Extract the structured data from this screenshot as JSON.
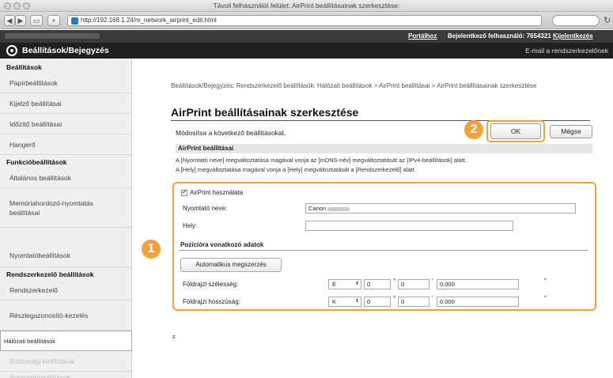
{
  "browser": {
    "window_title": "Távoli felhasználói felület: AirPrint beállításainak szerkesztése:",
    "url": "http://192.168.1.24/m_network_airprint_edit.html",
    "nav_back": "◀",
    "nav_forward": "▶",
    "add_tab": "+",
    "reload": "↻",
    "search_label": "C"
  },
  "app": {
    "top_links": {
      "portal": "Portálhoz",
      "login_label": "Bejelentkező felhasználó:",
      "user_id": "7654321",
      "logout": "Kijelentkezés"
    },
    "header_title": "Beállítások/Bejegyzés",
    "header_right": "E-mail a rendszerkezelőnek"
  },
  "sidebar": {
    "sections": [
      {
        "title": "Beállítások",
        "items": [
          "Papírbeállítások",
          "Kijelző beállításai",
          "Időzítő beállításai",
          "Hangerő"
        ]
      },
      {
        "title": "Funkcióbeállítások",
        "items": [
          "Általános beállítások",
          "Memóriahordozó-nyomtatás beállításai",
          "Nyomtatóbeállítások"
        ]
      },
      {
        "title": "Rendszerkezelő beállítások",
        "items": [
          "Rendszerkezelő",
          "Részlegazonosító-kezelés",
          "Hálózati beállítások",
          "Biztonsági beállítások",
          "Nyomtatóbeállítások"
        ]
      }
    ],
    "selected": "Hálózati beállítások"
  },
  "page": {
    "breadcrumb": "Beállítások/Bejegyzés: Rendszerkezelő beállítások: Hálózati beállítások > AirPrint beállításai > AirPrint beállításainak szerkesztése",
    "title": "AirPrint beállításainak szerkesztése",
    "instruction": "Módosítsa a következő beállításokat.",
    "ok_label": "OK",
    "cancel_label": "Mégse",
    "section_title": "AirPrint beállításai",
    "notes": [
      "A [Nyomtató neve] megváltoztatása magával vonja az [mDNS-név] megváltoztatását az [IPv4-beállítások] alatt.",
      "A [Hely] megváltoztatása magával vonja a [Hely] megváltoztatását a [Rendszerkezelő] alatt."
    ],
    "use_airprint_label": "AirPrint használata",
    "use_airprint_checked": true,
    "printer_name_label": "Nyomtató neve:",
    "printer_name_value": "Canon",
    "location_label": "Hely:",
    "location_value": "",
    "position_section": "Pozícióra vonatkozó adatok",
    "auto_button": "Automatikus megszerzés",
    "latitude": {
      "label": "Földrajzi szélesség:",
      "dir": "É",
      "deg": "0",
      "min": "0",
      "sec": "0.000"
    },
    "longitude": {
      "label": "Földrajzi hosszúság:",
      "dir": "K",
      "deg": "0",
      "min": "0",
      "sec": "0.000"
    },
    "deg_mark": "°",
    "min_mark": "'",
    "sec_mark": "\"",
    "top_link": "⌅"
  },
  "callouts": {
    "first": "1",
    "second": "2"
  },
  "colors": {
    "highlight": "#f3a23a",
    "header_bg": "#1f1f1f"
  }
}
